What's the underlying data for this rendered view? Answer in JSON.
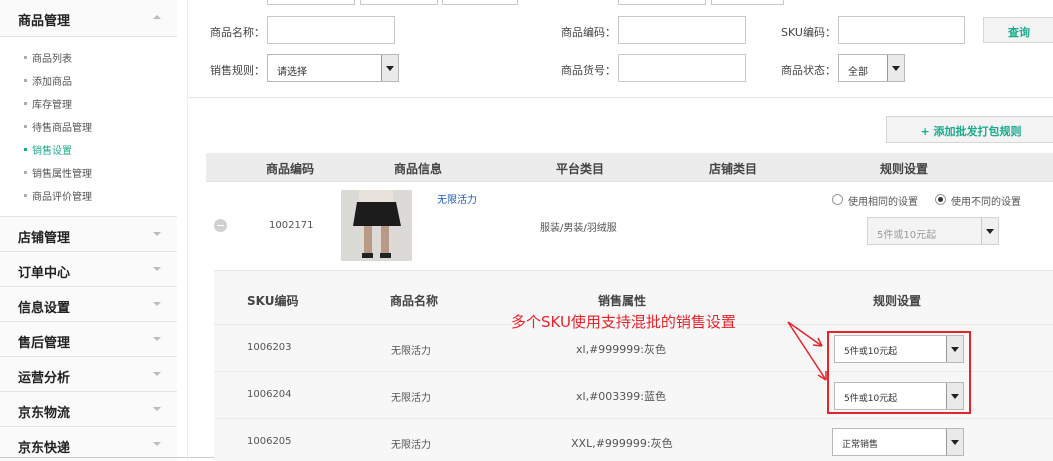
{
  "sidebar": {
    "product_mgmt": "商品管理",
    "sub_items": [
      "商品列表",
      "添加商品",
      "库存管理",
      "待售商品管理",
      "销售设置",
      "销售属性管理",
      "商品评价管理"
    ],
    "categories": [
      "店铺管理",
      "订单中心",
      "信息设置",
      "售后管理",
      "运营分析",
      "京东物流",
      "京东快递"
    ]
  },
  "search": {
    "name_label": "商品名称：",
    "code_label": "商品编码：",
    "sku_label": "SKU编码：",
    "rule_label": "销售规则：",
    "rule_value": "请选择",
    "artno_label": "商品货号：",
    "status_label": "商品状态：",
    "status_value": "全部",
    "query_button": "查询"
  },
  "add_rule_button": "+ 添加批发打包规则",
  "table": {
    "headers": [
      "商品编码",
      "商品信息",
      "平台类目",
      "店铺类目",
      "规则设置"
    ],
    "product": {
      "code": "1002171",
      "name": "无限活力",
      "category": "服装/男装/羽绒服",
      "option_same": "使用相同的设置",
      "option_diff": "使用不同的设置",
      "rule_value": "5件或10元起"
    }
  },
  "sku_table": {
    "headers": [
      "SKU编码",
      "商品名称",
      "销售属性",
      "规则设置"
    ],
    "rows": [
      {
        "code": "1006203",
        "name": "无限活力",
        "attr": "xl,#999999:灰色",
        "rule": "5件或10元起"
      },
      {
        "code": "1006204",
        "name": "无限活力",
        "attr": "xl,#003399:蓝色",
        "rule": "5件或10元起"
      },
      {
        "code": "1006205",
        "name": "无限活力",
        "attr": "XXL,#999999:灰色",
        "rule": "正常销售"
      }
    ]
  },
  "annotation": {
    "text": "多个SKU使用支持混批的销售设置",
    "color": "#e8232a"
  }
}
